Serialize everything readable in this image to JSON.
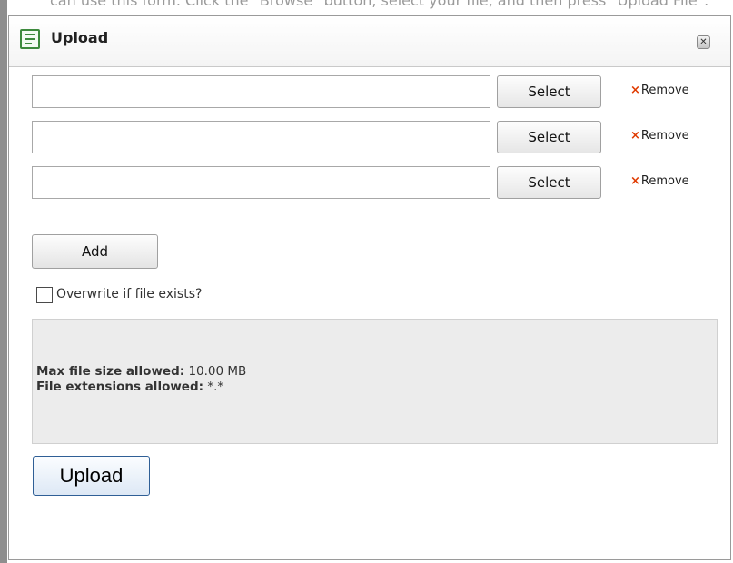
{
  "background": {
    "instruction_text": "can use this form. Click the \"Browse\" button, select your file, and then press \"Upload File\"."
  },
  "dialog": {
    "title": "Upload",
    "title_icon": "form-icon",
    "close_icon": "close-icon"
  },
  "file_rows": [
    {
      "value": "",
      "select_label": "Select",
      "remove_label": "Remove"
    },
    {
      "value": "",
      "select_label": "Select",
      "remove_label": "Remove"
    },
    {
      "value": "",
      "select_label": "Select",
      "remove_label": "Remove"
    }
  ],
  "remove_marker": "×",
  "add_label": "Add",
  "overwrite": {
    "label": "Overwrite if file exists?",
    "checked": false
  },
  "info": {
    "max_size_label": "Max file size allowed:",
    "max_size_value": "10.00 MB",
    "extensions_label": "File extensions allowed:",
    "extensions_value": "*.*"
  },
  "upload_label": "Upload",
  "colors": {
    "remove_x": "#e03a00",
    "icon_green": "#3d8a3d",
    "info_bg": "#ececec"
  }
}
